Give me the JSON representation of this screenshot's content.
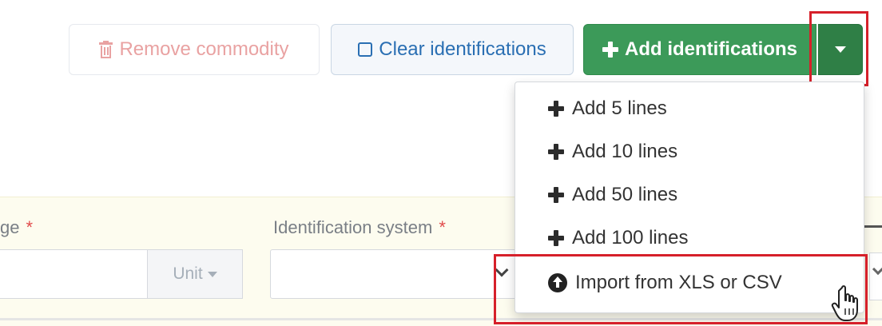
{
  "toolbar": {
    "remove_label": "Remove commodity",
    "clear_label": "Clear identifications",
    "add_label": "Add identifications"
  },
  "dropdown": {
    "items": [
      {
        "label": "Add 5 lines",
        "icon": "plus-icon"
      },
      {
        "label": "Add 10 lines",
        "icon": "plus-icon"
      },
      {
        "label": "Add 50 lines",
        "icon": "plus-icon"
      },
      {
        "label": "Add 100 lines",
        "icon": "plus-icon"
      },
      {
        "label": "Import from XLS or CSV",
        "icon": "upload-circle-icon"
      }
    ]
  },
  "form": {
    "range_label": "ge",
    "required_marker": "*",
    "unit_label": "Unit",
    "identification_system_label": "Identification system"
  },
  "colors": {
    "primary_green": "#3c9a59",
    "caret_green": "#2f7f46",
    "link_blue": "#2a6fb3",
    "disabled_red": "#e9a2a2",
    "highlight_red": "#d6202a",
    "required_red": "#e14b4b",
    "form_background": "#fdfcef"
  }
}
